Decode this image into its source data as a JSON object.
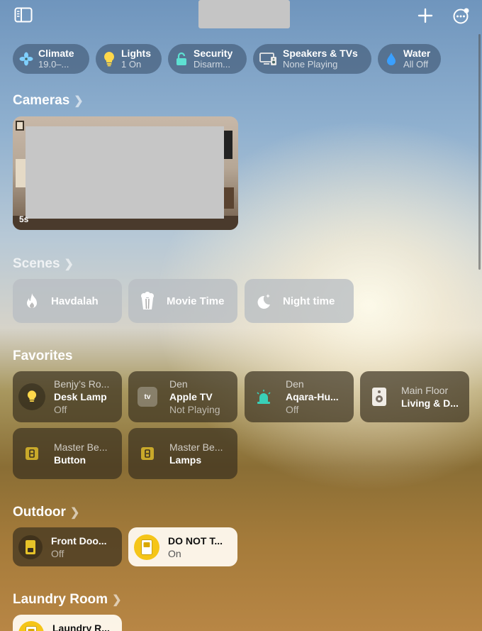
{
  "categories": [
    {
      "title": "Climate",
      "sub": "19.0–...",
      "icon": "fan-icon",
      "color": "#7fd0ff"
    },
    {
      "title": "Lights",
      "sub": "1 On",
      "icon": "lightbulb-icon",
      "color": "#ffd84a"
    },
    {
      "title": "Security",
      "sub": "Disarm...",
      "icon": "lock-icon",
      "color": "#5ee0d2"
    },
    {
      "title": "Speakers & TVs",
      "sub": "None Playing",
      "icon": "tv-speaker-icon",
      "color": "#e8e8e8"
    },
    {
      "title": "Water",
      "sub": "All Off",
      "icon": "water-drop-icon",
      "color": "#3aa0ff"
    }
  ],
  "sections": {
    "cameras": "Cameras",
    "scenes": "Scenes",
    "favorites": "Favorites",
    "outdoor": "Outdoor",
    "laundry": "Laundry Room"
  },
  "camera": {
    "age": "5s"
  },
  "scenes": [
    {
      "label": "Havdalah",
      "icon": "flame-icon"
    },
    {
      "label": "Movie Time",
      "icon": "popcorn-icon"
    },
    {
      "label": "Night time",
      "icon": "moon-stars-icon"
    }
  ],
  "favorites": [
    {
      "room": "Benjy’s Ro...",
      "name": "Desk Lamp",
      "status": "Off",
      "icon": "lightbulb-icon"
    },
    {
      "room": "Den",
      "name": "Apple TV",
      "status": "Not Playing",
      "icon": "apple-tv-icon",
      "badge": "tv"
    },
    {
      "room": "Den",
      "name": "Aqara-Hu...",
      "status": "Off",
      "icon": "siren-icon"
    },
    {
      "room": "Main Floor",
      "name": "Living & D...",
      "status": "",
      "icon": "speaker-icon"
    },
    {
      "room": "Master Be...",
      "name": "Button",
      "status": "",
      "icon": "switch-icon"
    },
    {
      "room": "Master Be...",
      "name": "Lamps",
      "status": "",
      "icon": "switch-icon"
    }
  ],
  "outdoor": [
    {
      "name": "Front Doo...",
      "status": "Off",
      "icon": "switch-icon",
      "on": false
    },
    {
      "name": "DO NOT T...",
      "status": "On",
      "icon": "switch-icon",
      "on": true
    }
  ],
  "laundry": [
    {
      "name": "Laundry R...",
      "icon": "switch-icon",
      "on": true
    }
  ]
}
